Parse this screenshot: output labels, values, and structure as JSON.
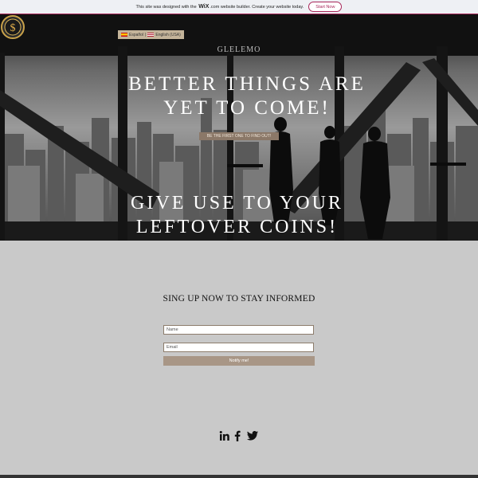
{
  "wix_banner": {
    "prefix": "This site was designed with the",
    "brand": "WiX",
    "suffix": ".com website builder. Create your website today.",
    "cta": "Start Now"
  },
  "language": {
    "option1": "Español",
    "option2": "English (USA)"
  },
  "logo": {
    "text": "GLELEMO"
  },
  "hero": {
    "title": "BETTER THINGS ARE YET TO COME!",
    "cta": "BE THE FIRST ONE TO FIND OUT!",
    "subtitle": "GIVE USE TO YOUR LEFTOVER COINS!"
  },
  "signup": {
    "heading": "SING UP NOW TO  STAY INFORMED",
    "name_placeholder": "Name",
    "email_placeholder": "Email",
    "button": "Notify me!"
  },
  "social": {
    "icons": [
      "linkedin-icon",
      "facebook-icon",
      "twitter-icon"
    ]
  },
  "colors": {
    "accent": "#a8275a",
    "button_brown": "#8b7868",
    "form_button": "#a89686",
    "page_bg": "#c9c9c9"
  }
}
